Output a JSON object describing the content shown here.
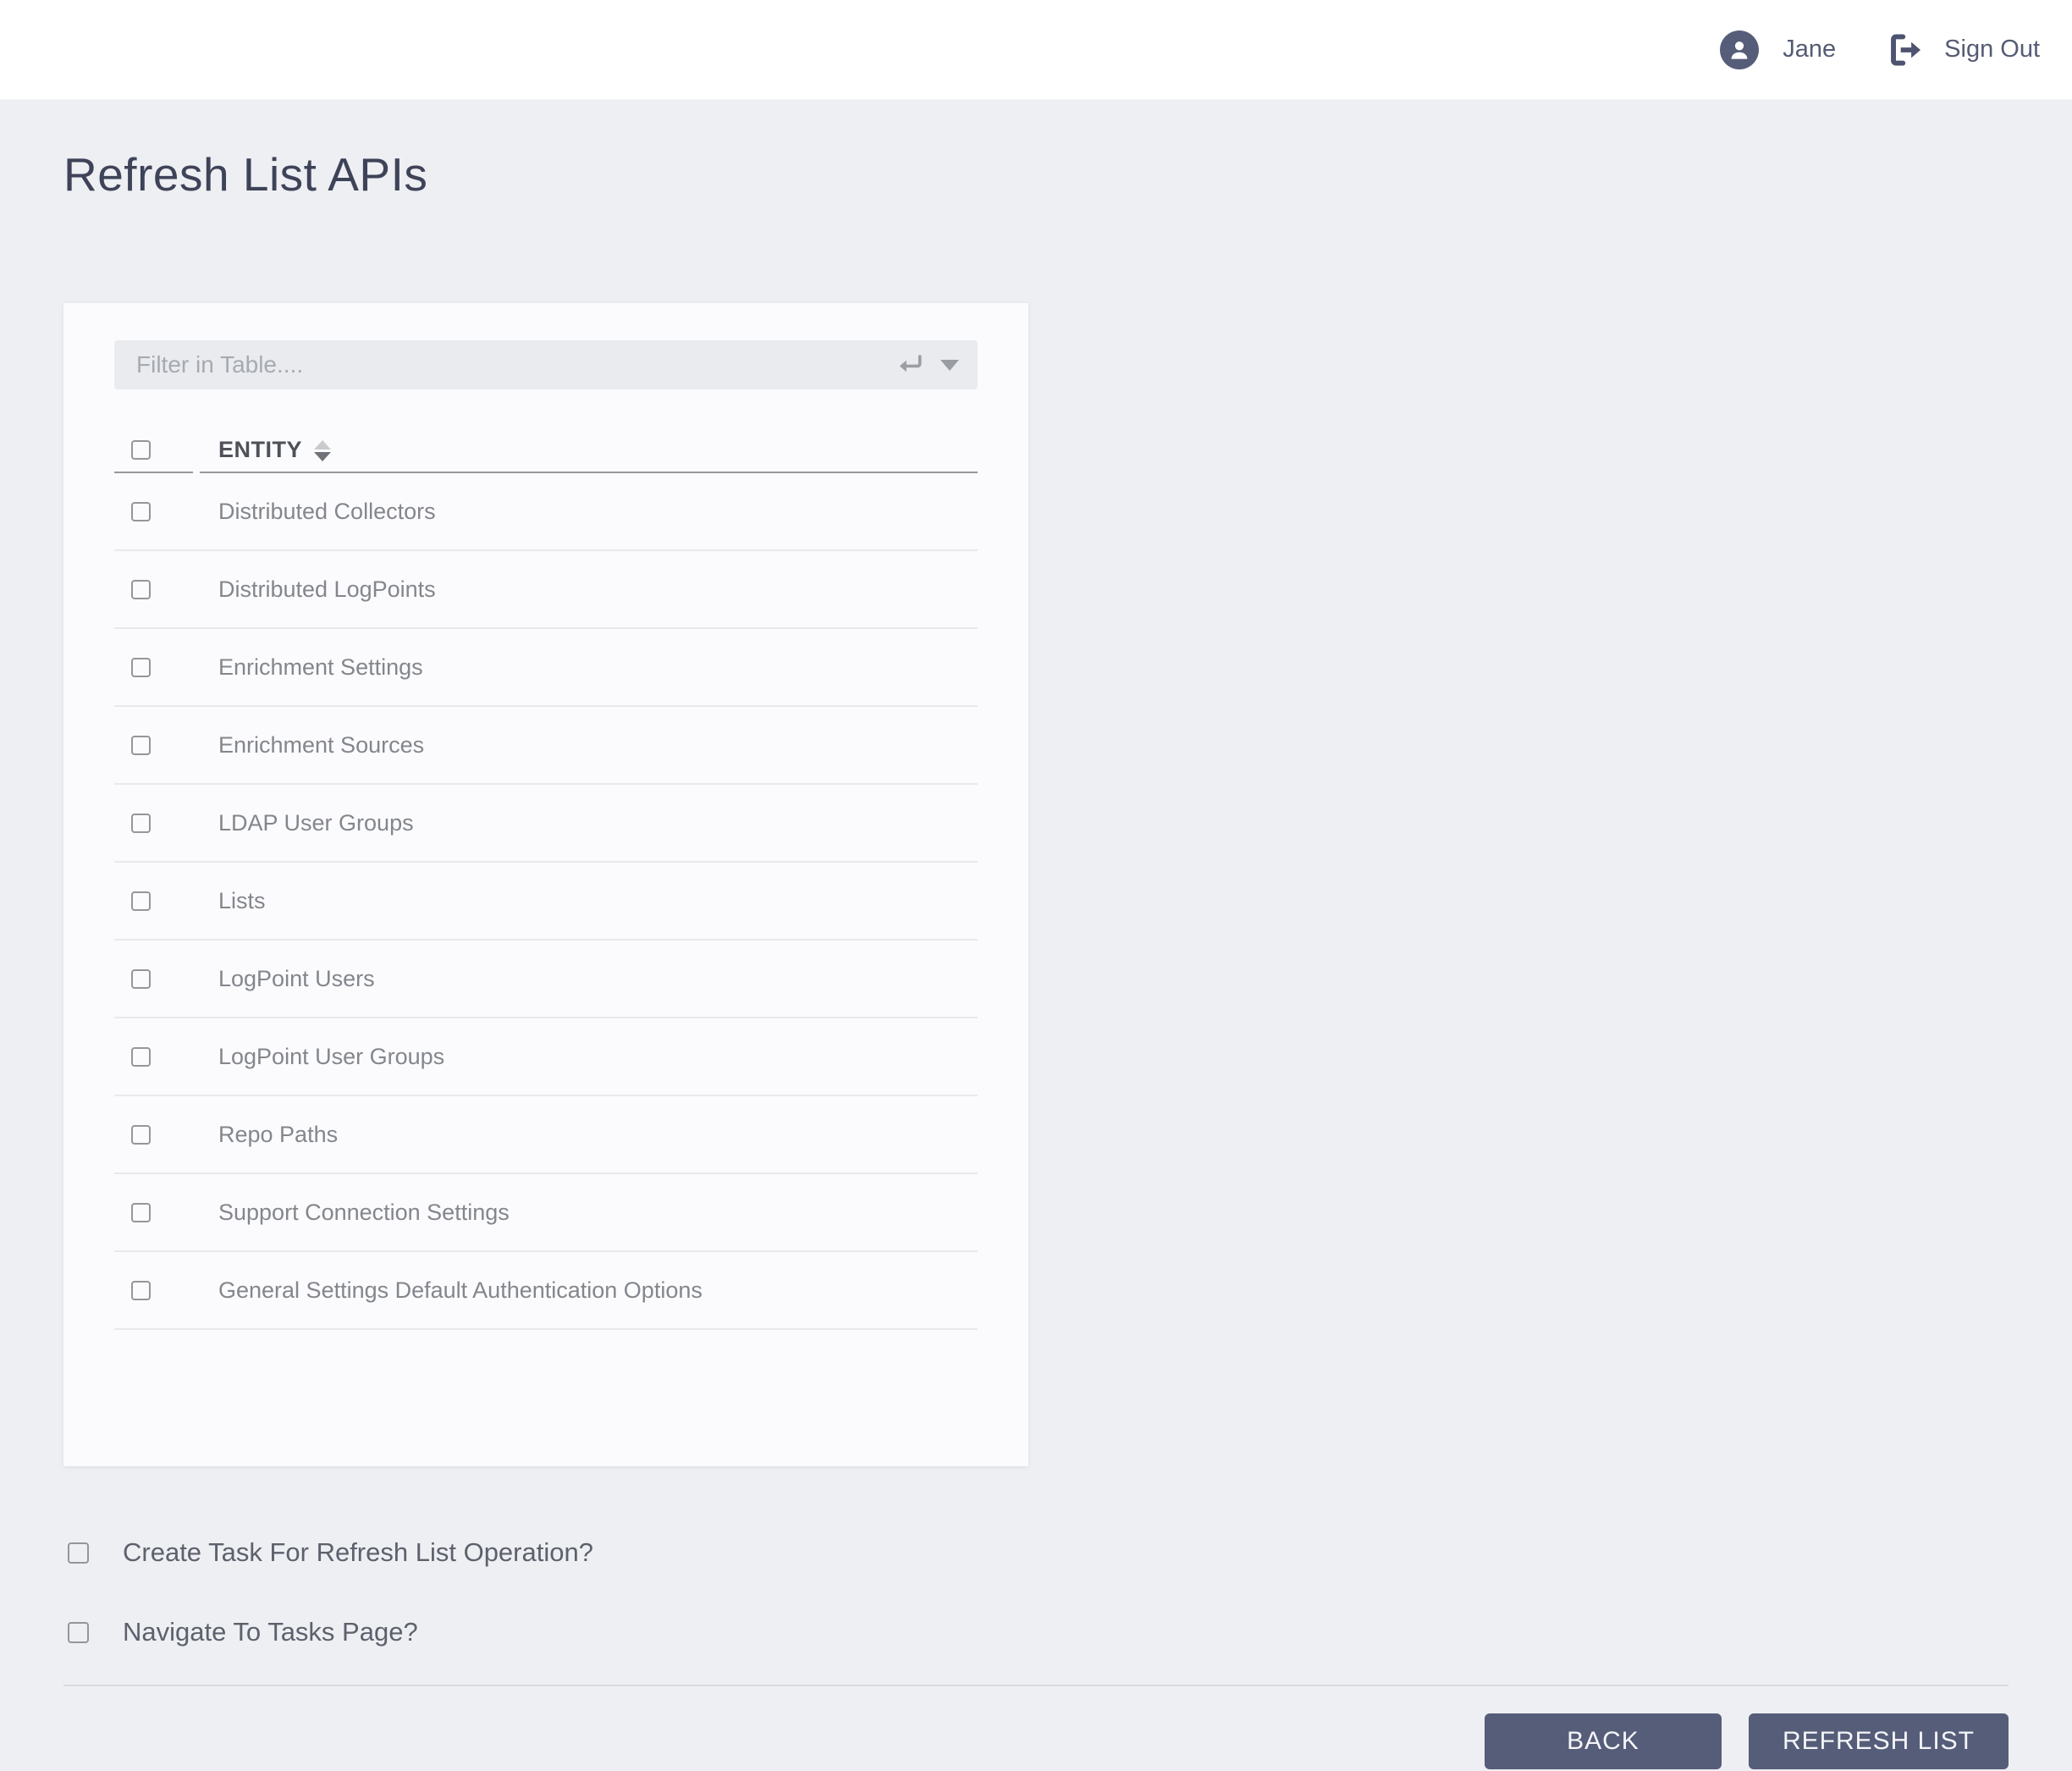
{
  "header": {
    "user_name": "Jane",
    "sign_out_label": "Sign Out"
  },
  "page": {
    "title": "Refresh List APIs"
  },
  "filter": {
    "placeholder": "Filter in Table...."
  },
  "table": {
    "column_header": "ENTITY",
    "rows": [
      "Distributed Collectors",
      "Distributed LogPoints",
      "Enrichment Settings",
      "Enrichment Sources",
      "LDAP User Groups",
      "Lists",
      "LogPoint Users",
      "LogPoint User Groups",
      "Repo Paths",
      "Support Connection Settings",
      "General Settings Default Authentication Options"
    ]
  },
  "options": [
    {
      "label": "Create Task For Refresh List Operation?"
    },
    {
      "label": "Navigate To Tasks Page?"
    }
  ],
  "footer": {
    "back_label": "BACK",
    "refresh_label": "REFRESH LIST"
  },
  "colors": {
    "accent": "#565d79",
    "page_background": "#edeff3",
    "card_background": "#fbfbfd",
    "title_text": "#3e4358",
    "row_text": "#83868c",
    "header_underline": "#97989b"
  }
}
